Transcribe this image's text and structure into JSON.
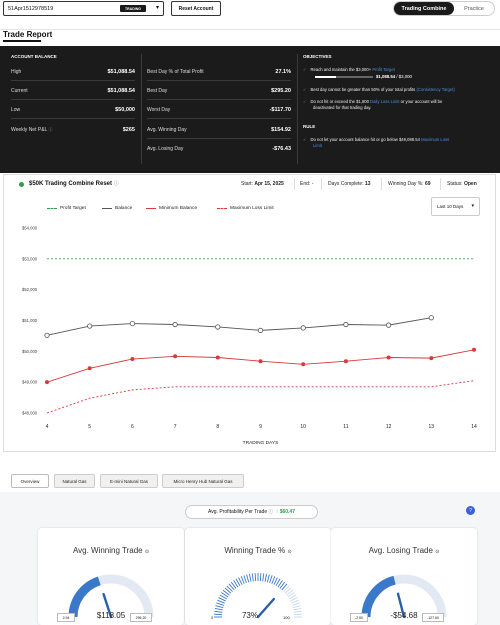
{
  "topbar": {
    "account_id": "51Apr1512978519",
    "account_badge": "TRADING",
    "reset_label": "Reset Account",
    "toggle_active": "Trading Combine",
    "toggle_inactive": "Practice"
  },
  "page_title": "Trade Report",
  "balance": {
    "section_title": "ACCOUNT BALANCE",
    "left": [
      {
        "label": "High",
        "value": "$51,088.54"
      },
      {
        "label": "Current",
        "value": "$51,088.54"
      },
      {
        "label": "Low",
        "value": "$50,000"
      },
      {
        "label": "Weekly Net P&L",
        "value": "$265"
      }
    ],
    "right": [
      {
        "label": "Best Day % of Total Profit",
        "value": "27.1%"
      },
      {
        "label": "Best Day",
        "value": "$295.20"
      },
      {
        "label": "Worst Day",
        "value": "-$117.70"
      },
      {
        "label": "Avg. Winning Day",
        "value": "$154.92"
      },
      {
        "label": "Avg. Losing Day",
        "value": "-$76.43"
      }
    ]
  },
  "objectives": {
    "title": "OBJECTIVES",
    "item1_text": "Reach and maintain the $3,000+",
    "item1_link": "Profit Target",
    "progress_value": "$1,088.54",
    "progress_target": "/ $3,000",
    "progress_fraction": 0.363,
    "item2_text": "Best day cannot be greater than 50% of your total profits",
    "item2_link": "(Consistency Target)",
    "item3_a": "Do not hit or exceed the $1,800",
    "item3_link": "Daily Loss Limit",
    "item3_b": "or your account will be",
    "item3_c": "deactivated for that trading day.",
    "rule_title": "RULE",
    "rule_text": "Do not let your account balance hit or go below $49,088.54",
    "rule_link": "Maximum Loss",
    "rule_link2": "Limit"
  },
  "chart_header": {
    "title": "$50K Trading Combine Reset",
    "start_label": "Start:",
    "start_value": "Apr 15, 2025",
    "end_label": "End:",
    "end_value": "-",
    "days_label": "Days Complete:",
    "days_value": "13",
    "winday_label": "Winning Day %:",
    "winday_value": "69",
    "status_label": "Status:",
    "status_value": "Open",
    "range_select": "Last 10 Days"
  },
  "colors": {
    "profit_target": "#2e9e4f",
    "balance": "#555555",
    "min_balance": "#d63a3a",
    "max_loss": "#d63a3a",
    "link": "#4a8fe0"
  },
  "chart_data": {
    "type": "line",
    "x": [
      4,
      5,
      6,
      7,
      8,
      9,
      10,
      11,
      12,
      13,
      14
    ],
    "xlabel": "TRADING DAYS",
    "ylabel": "",
    "ylim": [
      48000,
      54000
    ],
    "y_ticks": [
      "$54,000",
      "$53,000",
      "$52,000",
      "$51,000",
      "$50,000",
      "$49,000",
      "$48,000"
    ],
    "series": [
      {
        "name": "Profit Target",
        "style": "dashed",
        "x": [
          4,
          14
        ],
        "values": [
          53000,
          53000
        ]
      },
      {
        "name": "Balance",
        "style": "solid-markers",
        "x": [
          4,
          5,
          6,
          7,
          8,
          9,
          10,
          11,
          12,
          13
        ],
        "values": [
          50520,
          50820,
          50900,
          50870,
          50790,
          50680,
          50760,
          50870,
          50850,
          51090
        ]
      },
      {
        "name": "Minimum Balance",
        "style": "solid-markers",
        "x": [
          4,
          5,
          6,
          7,
          8,
          9,
          10,
          11,
          12,
          13,
          14
        ],
        "values": [
          49000,
          49450,
          49750,
          49840,
          49800,
          49680,
          49580,
          49680,
          49800,
          49780,
          50050
        ]
      },
      {
        "name": "Maximum Loss Limit",
        "style": "dashed",
        "x": [
          4,
          5,
          6,
          7,
          8,
          9,
          10,
          11,
          12,
          13,
          14
        ],
        "values": [
          48000,
          48480,
          48750,
          48850,
          48850,
          48850,
          48850,
          48850,
          48850,
          48850,
          49050
        ]
      }
    ],
    "legend": "top-left",
    "grid": false
  },
  "tabs": [
    "Overview",
    "Natural Gas",
    "E-mini Natural Gas",
    "Micro Henry Hub Natural Gas"
  ],
  "profitability": {
    "label": "Avg. Profitability Per Trade",
    "arrow": "↑",
    "value": "$60.47"
  },
  "gauges": [
    {
      "title": "Avg. Winning Trade",
      "value": "$118.05",
      "min": "2.94",
      "max": "295.20",
      "fraction": 0.4
    },
    {
      "title": "Winning Trade %",
      "value": "73%",
      "min": "0",
      "max": "100",
      "fraction": 0.73
    },
    {
      "title": "Avg. Losing Trade",
      "value": "-$54.68",
      "min": "-2.60",
      "max": "-127.60",
      "fraction": 0.42
    }
  ]
}
